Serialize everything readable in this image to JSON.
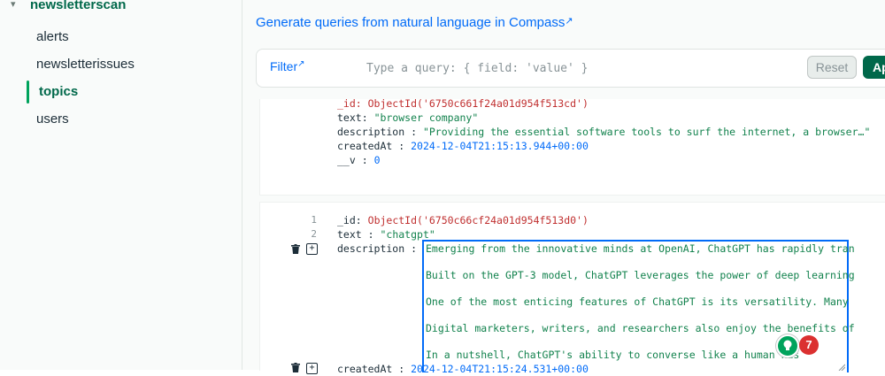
{
  "sidebar": {
    "database": "newsletterscan",
    "collections": [
      {
        "label": "alerts"
      },
      {
        "label": "newsletterissues"
      },
      {
        "label": "topics"
      },
      {
        "label": "users"
      }
    ],
    "active_collection": "topics"
  },
  "header": {
    "generate_link": "Generate queries from natural language in Compass"
  },
  "filter": {
    "label": "Filter",
    "placeholder": "Type a query: { field: 'value' }",
    "reset_label": "Reset",
    "apply_label": "Ap"
  },
  "documents": [
    {
      "id_line": "_id: ObjectId('6750c661f24a01d954f513cd')",
      "fields": [
        {
          "key": "text",
          "value": "\"browser company\""
        },
        {
          "key": "description",
          "value": "\"Providing the essential software tools to surf the internet, a browser…\""
        },
        {
          "key": "createdAt",
          "value": "2024-12-04T21:15:13.944+00:00"
        },
        {
          "key": "__v",
          "value": "0"
        }
      ]
    },
    {
      "line_numbers": [
        "1",
        "2"
      ],
      "id_key": "_id",
      "id_value": "ObjectId('6750c66cf24a01d954f513d0')",
      "text_key": "text",
      "text_value": "\"chatgpt\"",
      "description_key": "description",
      "description_quote": "\"",
      "description_lines": [
        "Emerging from the innovative minds at OpenAI, ChatGPT has rapidly tran",
        "",
        "Built on the GPT-3 model, ChatGPT leverages the power of deep learning",
        "",
        "One of the most enticing features of ChatGPT is its versatility. Many",
        "",
        "Digital marketers, writers, and researchers also enjoy the benefits of",
        "",
        "In a nutshell, ChatGPT's ability to converse like a human has"
      ],
      "created_key": "createdAt",
      "created_value": "2024-12-04T21:15:24.531+00:00"
    }
  ],
  "badges": {
    "count": "7"
  },
  "colors": {
    "accent_green": "#00684a",
    "link_blue": "#016bf8",
    "string_green": "#12824d",
    "objectid_red": "#c03030",
    "badge_red": "#db3030"
  }
}
